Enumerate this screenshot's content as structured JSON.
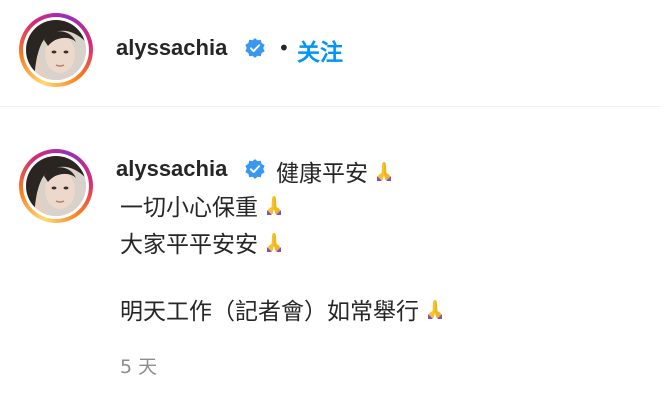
{
  "header": {
    "username": "alyssachia",
    "separator": "•",
    "follow_label": "关注"
  },
  "comment": {
    "username": "alyssachia",
    "lines": [
      "健康平安",
      "一切小心保重",
      "大家平平安安",
      "",
      "明天工作（記者會）如常舉行"
    ],
    "timestamp": "5 天"
  },
  "colors": {
    "accent": "#0095f6",
    "verified": "#3897f0",
    "muted": "#8e8e8e",
    "text": "#262626"
  },
  "icons": {
    "verified": "verified-badge-icon",
    "emoji": "folded-hands-emoji"
  }
}
